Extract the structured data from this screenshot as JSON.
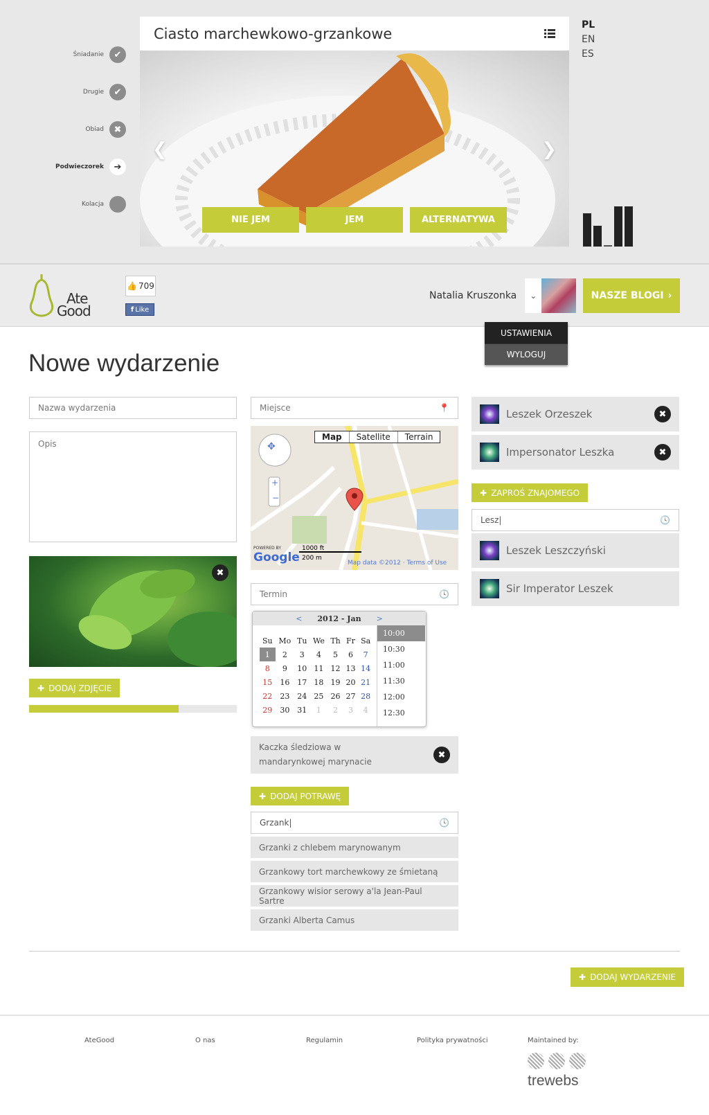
{
  "meals": [
    {
      "label": "Śniadanie",
      "icon": "check-icon"
    },
    {
      "label": "Drugie",
      "icon": "check-icon"
    },
    {
      "label": "Obiad",
      "icon": "close-icon"
    },
    {
      "label": "Podwieczorek",
      "icon": "arrow-right-icon"
    },
    {
      "label": "Kolacja",
      "icon": "dot-icon"
    }
  ],
  "hero": {
    "dish_title": "Ciasto marchewkowo-grzankowe",
    "votes": [
      "NIE JEM",
      "JEM",
      "ALTERNATYWA"
    ]
  },
  "languages": [
    "PL",
    "EN",
    "ES"
  ],
  "selected_language": "PL",
  "header": {
    "logo_line1": "Ate",
    "logo_line2": "Good",
    "fb_count": "709",
    "fb_like": "Like",
    "user_name": "Natalia Kruszonka",
    "blogs_button": "NASZE BLOGI",
    "user_menu": [
      "USTAWIENIA",
      "WYLOGUJ"
    ]
  },
  "page_title": "Nowe wydarzenie",
  "form": {
    "name_placeholder": "Nazwa wydarzenia",
    "desc_placeholder": "Opis",
    "add_photo": "DODAJ ZDJĘCIE",
    "upload_progress": 0.72,
    "place_placeholder": "Miejsce",
    "map_types": [
      "Map",
      "Satellite",
      "Terrain"
    ],
    "map_scale_top": "1000 ft",
    "map_scale_bottom": "200 m",
    "map_attribution": "Map data ©2012 · Terms of Use",
    "map_powered": "POWERED BY",
    "map_google": "Google",
    "date_placeholder": "Termin",
    "calendar_title": "2012 - Jan",
    "weekdays": [
      "Su",
      "Mo",
      "Tu",
      "We",
      "Th",
      "Fr",
      "Sa"
    ],
    "calendar_rows": [
      [
        "1",
        "2",
        "3",
        "4",
        "5",
        "6",
        "7"
      ],
      [
        "8",
        "9",
        "10",
        "11",
        "12",
        "13",
        "14"
      ],
      [
        "15",
        "16",
        "17",
        "18",
        "19",
        "20",
        "21"
      ],
      [
        "22",
        "23",
        "24",
        "25",
        "26",
        "27",
        "28"
      ],
      [
        "29",
        "30",
        "31",
        "1",
        "2",
        "3",
        "4"
      ]
    ],
    "times": [
      "10:00",
      "10:30",
      "11:00",
      "11:30",
      "12:00",
      "12:30"
    ],
    "selected_dish": "Kaczka śledziowa w mandarynkowej marynacie",
    "add_dish": "DODAJ POTRAWĘ",
    "dish_search": "Grzank|",
    "dish_suggestions": [
      "Grzanki z chlebem marynowanym",
      "Grzankowy tort marchewkowy ze śmietaną",
      "Grzankowy wisior serowy a'la Jean-Paul Sartre",
      "Grzanki Alberta Camus"
    ],
    "invited": [
      "Leszek Orzeszek",
      "Impersonator Leszka"
    ],
    "invite_button": "ZAPROŚ ZNAJOMEGO",
    "friend_search": "Lesz|",
    "friend_suggestions": [
      "Leszek Leszczyński",
      "Sir Imperator Leszek"
    ],
    "submit": "DODAJ WYDARZENIE"
  },
  "footer": {
    "links": [
      "AteGood",
      "O nas",
      "Regulamin",
      "Polityka prywatności"
    ],
    "maintained": "Maintained by:",
    "brand": "trewebs"
  },
  "colors": {
    "accent": "#c4cc3a",
    "dark": "#222222"
  }
}
